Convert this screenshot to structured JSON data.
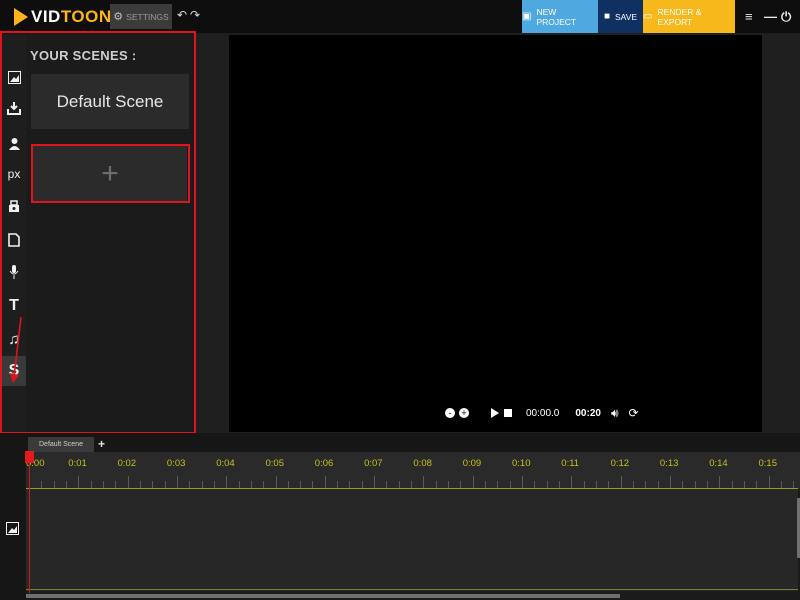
{
  "app": {
    "logo_vid": "VID",
    "logo_toon": "TOON"
  },
  "topbar": {
    "settings_label": "SETTINGS",
    "new_project_label": "NEW PROJECT",
    "save_label": "SAVE",
    "render_label": "RENDER & EXPORT",
    "colors": {
      "new_project": "#4fa8e0",
      "save": "#0f3060",
      "render": "#f6b81b"
    }
  },
  "toolbar_icons": [
    "image-icon",
    "download-icon",
    "person-icon",
    "px-icon",
    "props-icon",
    "document-icon",
    "microphone-icon",
    "text-icon",
    "music-icon",
    "scenes-icon"
  ],
  "scenes": {
    "title": "YOUR SCENES :",
    "items": [
      {
        "label": "Default Scene"
      }
    ],
    "add_label": "+"
  },
  "player": {
    "current_time": "00:00.0",
    "total_time": "00:20",
    "zoom_out": "-",
    "zoom_in": "+"
  },
  "timeline": {
    "tab_label": "Default Scene",
    "tab_add": "+",
    "ticks": [
      "0:00",
      "0:01",
      "0:02",
      "0:03",
      "0:04",
      "0:05",
      "0:06",
      "0:07",
      "0:08",
      "0:09",
      "0:10",
      "0:11",
      "0:12",
      "0:13",
      "0:14",
      "0:15"
    ],
    "playhead_time": "0:00"
  },
  "highlight_color": "#e0141e"
}
